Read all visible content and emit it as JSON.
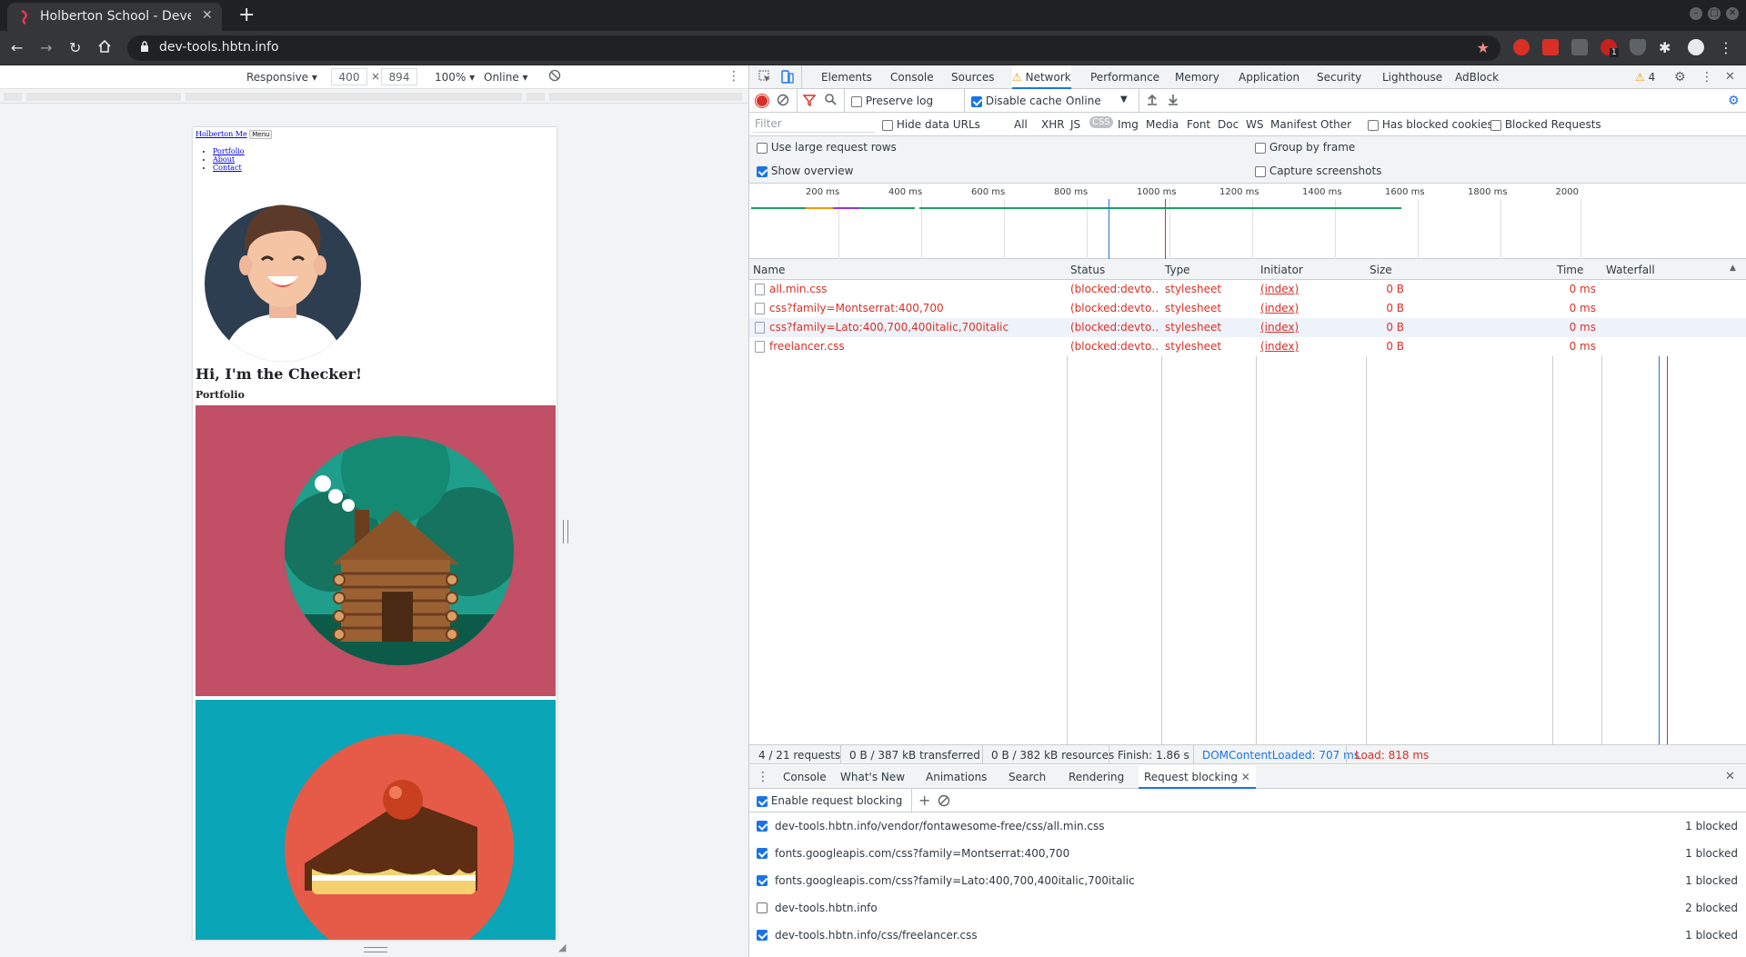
{
  "browser": {
    "tab_title": "Holberton School - Develop",
    "url": "dev-tools.hbtn.info",
    "extension_badge": "1"
  },
  "device_toolbar": {
    "mode": "Responsive",
    "width": "400",
    "times": "×",
    "height": "894",
    "zoom": "100%",
    "throttle": "Online"
  },
  "page": {
    "brand": "Holberton Me",
    "menu_button": "Menu",
    "nav": [
      "Portfolio",
      "About",
      "Contact"
    ],
    "hero_heading": "Hi, I'm the Checker!",
    "section_heading": "Portfolio"
  },
  "devtools": {
    "panels": [
      "Elements",
      "Console",
      "Sources",
      "Network",
      "Performance",
      "Memory",
      "Application",
      "Security",
      "Lighthouse",
      "AdBlock"
    ],
    "active_panel": "Network",
    "warning_count": "4",
    "toolbar": {
      "preserve_log": "Preserve log",
      "disable_cache": "Disable cache",
      "throttle": "Online"
    },
    "filter": {
      "placeholder": "Filter",
      "hide_data_urls": "Hide data URLs",
      "types": [
        "All",
        "XHR",
        "JS",
        "CSS",
        "Img",
        "Media",
        "Font",
        "Doc",
        "WS",
        "Manifest",
        "Other"
      ],
      "active_type": "CSS",
      "has_blocked_cookies": "Has blocked cookies",
      "blocked_requests": "Blocked Requests"
    },
    "settings": {
      "large_rows": "Use large request rows",
      "show_overview": "Show overview",
      "group_by_frame": "Group by frame",
      "capture_screenshots": "Capture screenshots"
    },
    "timeline_ticks": [
      "200 ms",
      "400 ms",
      "600 ms",
      "800 ms",
      "1000 ms",
      "1200 ms",
      "1400 ms",
      "1600 ms",
      "1800 ms",
      "2000"
    ],
    "columns": [
      "Name",
      "Status",
      "Type",
      "Initiator",
      "Size",
      "Time",
      "Waterfall"
    ],
    "requests": [
      {
        "name": "all.min.css",
        "status": "(blocked:devto…",
        "type": "stylesheet",
        "initiator": "(index)",
        "size": "0 B",
        "time": "0 ms"
      },
      {
        "name": "css?family=Montserrat:400,700",
        "status": "(blocked:devto…",
        "type": "stylesheet",
        "initiator": "(index)",
        "size": "0 B",
        "time": "0 ms"
      },
      {
        "name": "css?family=Lato:400,700,400italic,700italic",
        "status": "(blocked:devto…",
        "type": "stylesheet",
        "initiator": "(index)",
        "size": "0 B",
        "time": "0 ms"
      },
      {
        "name": "freelancer.css",
        "status": "(blocked:devto…",
        "type": "stylesheet",
        "initiator": "(index)",
        "size": "0 B",
        "time": "0 ms"
      }
    ],
    "status_bar": {
      "requests": "4 / 21 requests",
      "transferred": "0 B / 387 kB transferred",
      "resources": "0 B / 382 kB resources",
      "finish": "Finish: 1.86 s",
      "dcl": "DOMContentLoaded: 707 ms",
      "load": "Load: 818 ms"
    },
    "drawer_tabs": [
      "Console",
      "What's New",
      "Animations",
      "Search",
      "Rendering",
      "Request blocking"
    ],
    "active_drawer": "Request blocking",
    "enable_blocking": "Enable request blocking",
    "patterns": [
      {
        "pattern": "dev-tools.hbtn.info/vendor/fontawesome-free/css/all.min.css",
        "count": "1 blocked",
        "checked": true
      },
      {
        "pattern": "fonts.googleapis.com/css?family=Montserrat:400,700",
        "count": "1 blocked",
        "checked": true
      },
      {
        "pattern": "fonts.googleapis.com/css?family=Lato:400,700,400italic,700italic",
        "count": "1 blocked",
        "checked": true
      },
      {
        "pattern": "dev-tools.hbtn.info",
        "count": "2 blocked",
        "checked": false
      },
      {
        "pattern": "dev-tools.hbtn.info/css/freelancer.css",
        "count": "1 blocked",
        "checked": true
      }
    ]
  },
  "colors": {
    "accent": "#1a73e8",
    "blocked_red": "#d93025",
    "portfolio_bg1": "#c14f66",
    "portfolio_bg2": "#0aa5b7"
  }
}
